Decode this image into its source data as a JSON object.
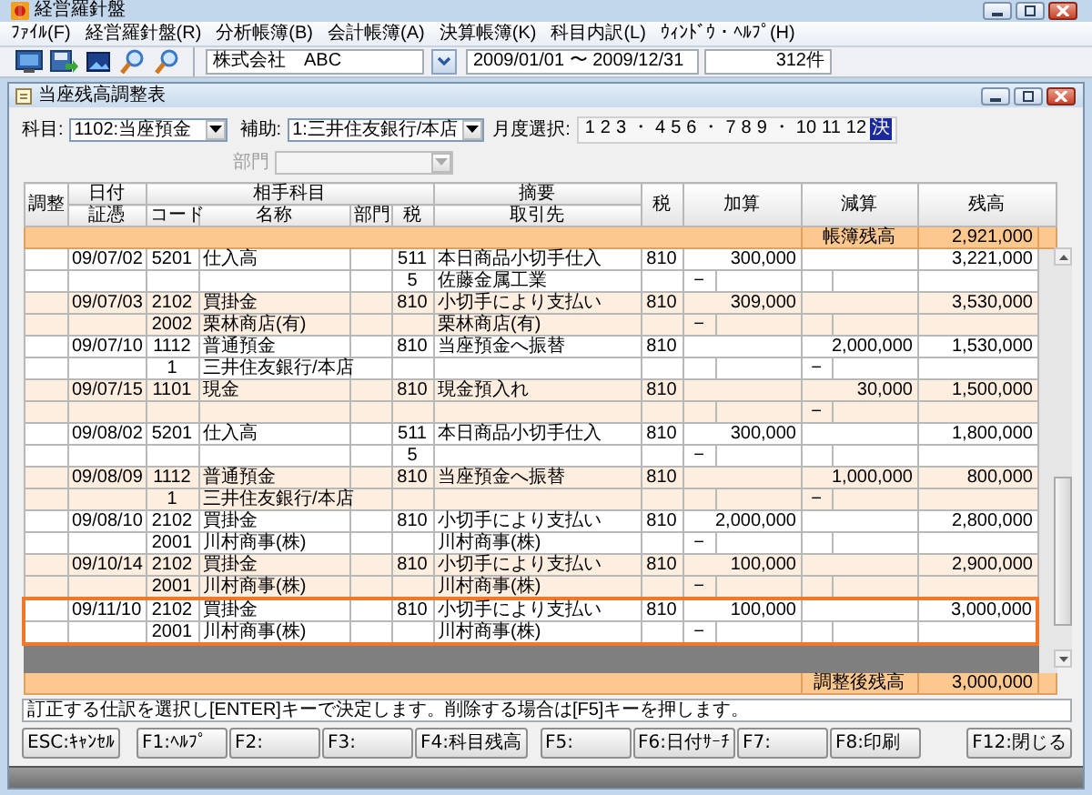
{
  "window": {
    "title": "経営羅針盤"
  },
  "menu": [
    {
      "label": "ﾌｧｲﾙ(F)"
    },
    {
      "label": "経営羅針盤(R)"
    },
    {
      "label": "分析帳簿(B)"
    },
    {
      "label": "会計帳簿(A)"
    },
    {
      "label": "決算帳簿(K)"
    },
    {
      "label": "科目内訳(L)"
    },
    {
      "label": "ｳｨﾝﾄﾞｳ・ﾍﾙﾌﾟ(H)"
    }
  ],
  "toolbar": {
    "company": "株式会社　ABC",
    "period": "2009/01/01 〜 2009/12/31",
    "count": "312件"
  },
  "report": {
    "title": "当座残高調整表",
    "filters": {
      "account_label": "科目:",
      "account": "1102:当座預金",
      "sub_label": "補助:",
      "sub_account": "1:三井住友銀行/本店",
      "month_label": "月度選択:",
      "dept_label": "部門",
      "dept_disabled": true,
      "months": [
        {
          "label": "1",
          "kind": "month",
          "selected": false
        },
        {
          "label": "2",
          "kind": "month",
          "selected": false
        },
        {
          "label": "3",
          "kind": "month",
          "selected": false
        },
        {
          "label": "・",
          "kind": "separator"
        },
        {
          "label": "4",
          "kind": "month",
          "selected": false
        },
        {
          "label": "5",
          "kind": "month",
          "selected": false
        },
        {
          "label": "6",
          "kind": "month",
          "selected": false
        },
        {
          "label": "・",
          "kind": "separator"
        },
        {
          "label": "7",
          "kind": "month",
          "selected": false
        },
        {
          "label": "8",
          "kind": "month",
          "selected": false
        },
        {
          "label": "9",
          "kind": "month",
          "selected": false
        },
        {
          "label": "・",
          "kind": "separator"
        },
        {
          "label": "10",
          "kind": "month",
          "selected": false
        },
        {
          "label": "11",
          "kind": "month",
          "selected": false
        },
        {
          "label": "12",
          "kind": "month",
          "selected": false
        },
        {
          "label": "決",
          "kind": "month",
          "selected": true
        }
      ]
    },
    "columns": {
      "adjust": "調整",
      "date": "日付",
      "voucher": "証憑",
      "counter_account": "相手科目",
      "code": "コード",
      "name": "名称",
      "dept": "部門",
      "tax": "税",
      "memo": "摘要",
      "partner": "取引先",
      "tax_class": "税",
      "add": "加算",
      "subtract": "減算",
      "balance": "残高"
    },
    "opening": {
      "label": "帳簿残高",
      "value": "2,921,000"
    },
    "entries": [
      {
        "date": "09/07/02",
        "code": "5201",
        "name": "仕入高",
        "tax": "511",
        "memo": "本日商品小切手仕入",
        "tax_class": "810",
        "add": "300,000",
        "balance": "3,221,000",
        "line2": {
          "tax": "5",
          "partner": "佐藤金属工業",
          "add_mark": "−"
        },
        "selected": false
      },
      {
        "date": "09/07/03",
        "code": "2102",
        "name": "買掛金",
        "tax": "810",
        "memo": "小切手により支払い",
        "tax_class": "810",
        "add": "309,000",
        "balance": "3,530,000",
        "line2": {
          "code": "2002",
          "name": "栗林商店(有)",
          "partner": "栗林商店(有)",
          "add_mark": "−"
        },
        "selected": false
      },
      {
        "date": "09/07/10",
        "code": "1112",
        "name": "普通預金",
        "tax": "810",
        "memo": "当座預金へ振替",
        "tax_class": "810",
        "subtract": "2,000,000",
        "balance": "1,530,000",
        "line2": {
          "code": "1",
          "name": "三井住友銀行/本店",
          "sub_mark": "−"
        },
        "selected": false
      },
      {
        "date": "09/07/15",
        "code": "1101",
        "name": "現金",
        "tax": "810",
        "memo": "現金預入れ",
        "tax_class": "810",
        "subtract": "30,000",
        "balance": "1,500,000",
        "line2": {
          "sub_mark": "−"
        },
        "selected": false
      },
      {
        "date": "09/08/02",
        "code": "5201",
        "name": "仕入高",
        "tax": "511",
        "memo": "本日商品小切手仕入",
        "tax_class": "810",
        "add": "300,000",
        "balance": "1,800,000",
        "line2": {
          "tax": "5",
          "add_mark": "−"
        },
        "selected": false
      },
      {
        "date": "09/08/09",
        "code": "1112",
        "name": "普通預金",
        "tax": "810",
        "memo": "当座預金へ振替",
        "tax_class": "810",
        "subtract": "1,000,000",
        "balance": "800,000",
        "line2": {
          "code": "1",
          "name": "三井住友銀行/本店",
          "sub_mark": "−"
        },
        "selected": false
      },
      {
        "date": "09/08/10",
        "code": "2102",
        "name": "買掛金",
        "tax": "810",
        "memo": "小切手により支払い",
        "tax_class": "810",
        "add": "2,000,000",
        "balance": "2,800,000",
        "line2": {
          "code": "2001",
          "name": "川村商事(株)",
          "partner": "川村商事(株)",
          "add_mark": "−"
        },
        "selected": false
      },
      {
        "date": "09/10/14",
        "code": "2102",
        "name": "買掛金",
        "tax": "810",
        "memo": "小切手により支払い",
        "tax_class": "810",
        "add": "100,000",
        "balance": "2,900,000",
        "line2": {
          "code": "2001",
          "name": "川村商事(株)",
          "partner": "川村商事(株)",
          "add_mark": "−"
        },
        "selected": false
      },
      {
        "date": "09/11/10",
        "code": "2102",
        "name": "買掛金",
        "tax": "810",
        "memo": "小切手により支払い",
        "tax_class": "810",
        "add": "100,000",
        "balance": "3,000,000",
        "line2": {
          "code": "2001",
          "name": "川村商事(株)",
          "partner": "川村商事(株)",
          "add_mark": "−"
        },
        "selected": true
      }
    ],
    "closing": {
      "label": "調整後残高",
      "value": "3,000,000"
    },
    "hint": "訂正する仕訳を選択し[ENTER]キーで決定します。削除する場合は[F5]キーを押します。",
    "function_keys": [
      {
        "label": "ESC:ｷｬﾝｾﾙ"
      },
      {
        "label": "F1:ﾍﾙﾌﾟ"
      },
      {
        "label": "F2:"
      },
      {
        "label": "F3:"
      },
      {
        "label": "F4:科目残高"
      },
      {
        "label": "F5:"
      },
      {
        "label": "F6:日付ｻｰﾁ"
      },
      {
        "label": "F7:"
      },
      {
        "label": "F8:印刷"
      },
      {
        "label": "F12:閉じる"
      }
    ]
  }
}
